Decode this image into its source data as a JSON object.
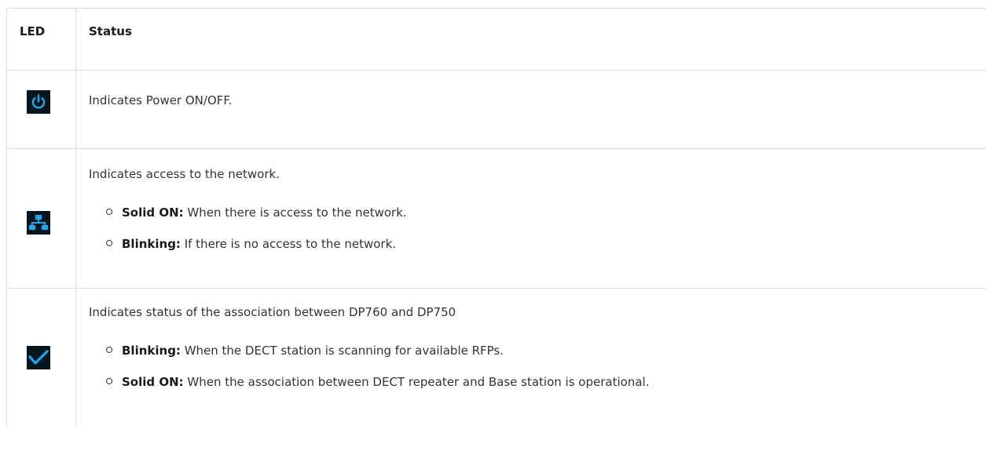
{
  "header": {
    "led": "LED",
    "status": "Status"
  },
  "rows": [
    {
      "icon": "power-icon",
      "description": "Indicates Power ON/OFF.",
      "bullets": []
    },
    {
      "icon": "network-icon",
      "description": "Indicates access to the network.",
      "bullets": [
        {
          "term": "Solid ON:",
          "text": " When there is access to the network."
        },
        {
          "term": "Blinking:",
          "text": " If there is no access to the network."
        }
      ]
    },
    {
      "icon": "checkmark-icon",
      "description": "Indicates status of the association between DP760 and DP750",
      "bullets": [
        {
          "term": "Blinking:",
          "text": " When the DECT station is scanning for available RFPs."
        },
        {
          "term": "Solid ON:",
          "text": " When the association between DECT repeater and Base station is operational."
        }
      ]
    }
  ],
  "colors": {
    "icon_bg": "#05161e",
    "icon_fg": "#19a9f0",
    "border": "#dcdcdc",
    "text": "#333333"
  }
}
